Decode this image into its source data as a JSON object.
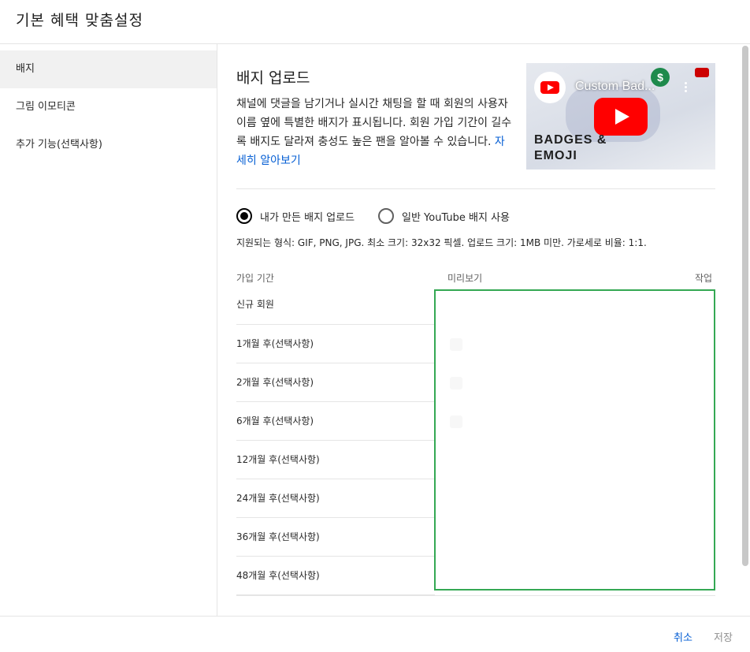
{
  "header": {
    "title": "기본 혜택 맞춤설정"
  },
  "sidebar": {
    "items": [
      {
        "label": "배지",
        "active": true
      },
      {
        "label": "그림 이모티콘",
        "active": false
      },
      {
        "label": "추가 기능(선택사항)",
        "active": false
      }
    ]
  },
  "main": {
    "title": "배지 업로드",
    "description": "채널에 댓글을 남기거나 실시간 채팅을 할 때 회원의 사용자 이름 옆에 특별한 배지가 표시됩니다. 회원 가입 기간이 길수록 배지도 달라져 충성도 높은 팬을 알아볼 수 있습니다.",
    "learn_more": "자세히 알아보기",
    "video": {
      "title": "Custom Bad...",
      "overlay_text": "BADGES &\nEMOJI",
      "money_glyph": "$"
    },
    "radio_options": [
      {
        "label": "내가 만든 배지 업로드",
        "selected": true
      },
      {
        "label": "일반 YouTube 배지 사용",
        "selected": false
      }
    ],
    "formats": "지원되는 형식: GIF, PNG, JPG. 최소 크기: 32x32 픽셀. 업로드 크기: 1MB 미만. 가로세로 비율: 1:1.",
    "table": {
      "headers": {
        "period": "가입 기간",
        "preview": "미리보기",
        "action": "작업"
      },
      "rows": [
        "신규 회원",
        "1개월 후(선택사항)",
        "2개월 후(선택사항)",
        "6개월 후(선택사항)",
        "12개월 후(선택사항)",
        "24개월 후(선택사항)",
        "36개월 후(선택사항)",
        "48개월 후(선택사항)"
      ]
    },
    "highlight_color": "#34a853"
  },
  "footer": {
    "cancel": "취소",
    "save": "저장"
  }
}
